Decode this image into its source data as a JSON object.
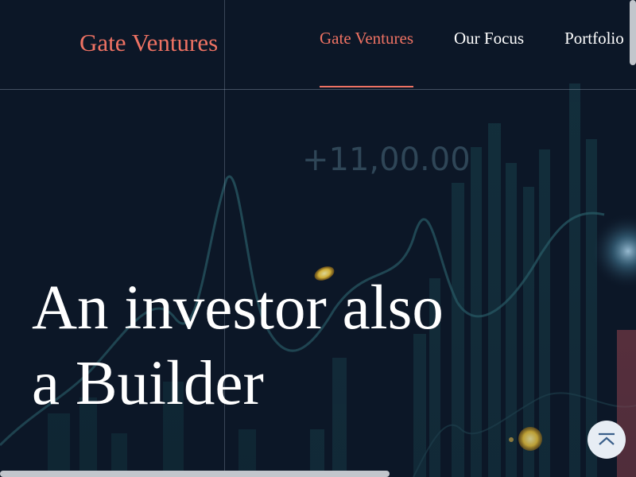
{
  "header": {
    "logo": "Gate Ventures",
    "nav": [
      {
        "label": "Gate Ventures",
        "active": true
      },
      {
        "label": "Our Focus",
        "active": false
      },
      {
        "label": "Portfolio",
        "active": false
      }
    ]
  },
  "hero": {
    "background_figure": "+11,00.00",
    "headline_line1": "An investor also",
    "headline_line2": "a Builder"
  },
  "back_to_top": {
    "icon": "arrow-up-to-top-icon"
  },
  "colors": {
    "accent": "#ee7263",
    "background": "#0c1727",
    "text": "#ffffff"
  }
}
